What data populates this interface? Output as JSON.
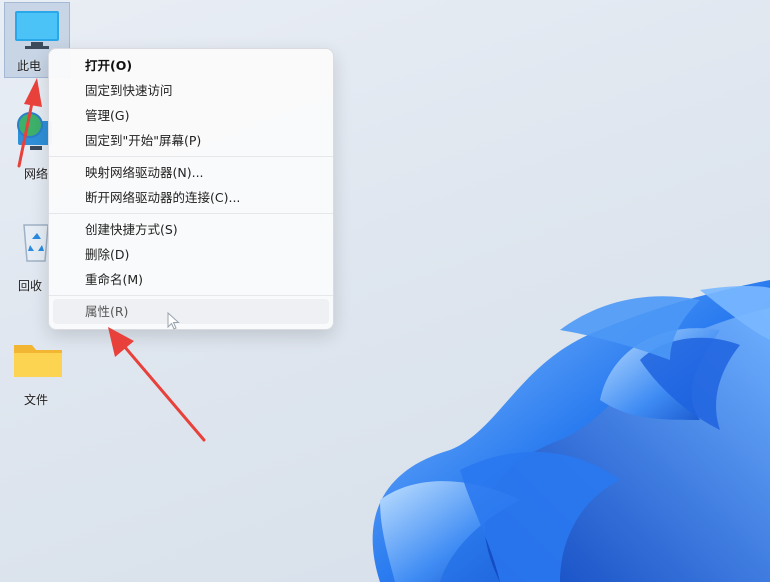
{
  "desktop": {
    "icons": [
      {
        "name": "this-pc",
        "label": "此电"
      },
      {
        "name": "network",
        "label": "网络"
      },
      {
        "name": "recycle-bin",
        "label": "回收"
      },
      {
        "name": "folder",
        "label": "文件"
      }
    ]
  },
  "context_menu": {
    "groups": [
      [
        "打开(O)",
        "固定到快速访问",
        "管理(G)",
        "固定到\"开始\"屏幕(P)"
      ],
      [
        "映射网络驱动器(N)...",
        "断开网络驱动器的连接(C)..."
      ],
      [
        "创建快捷方式(S)",
        "删除(D)",
        "重命名(M)"
      ],
      [
        "属性(R)"
      ]
    ]
  },
  "colors": {
    "annotation_arrow": "#e8403a",
    "bloom_blue": "#1f6fe6",
    "menu_bg": "#fafafb"
  }
}
